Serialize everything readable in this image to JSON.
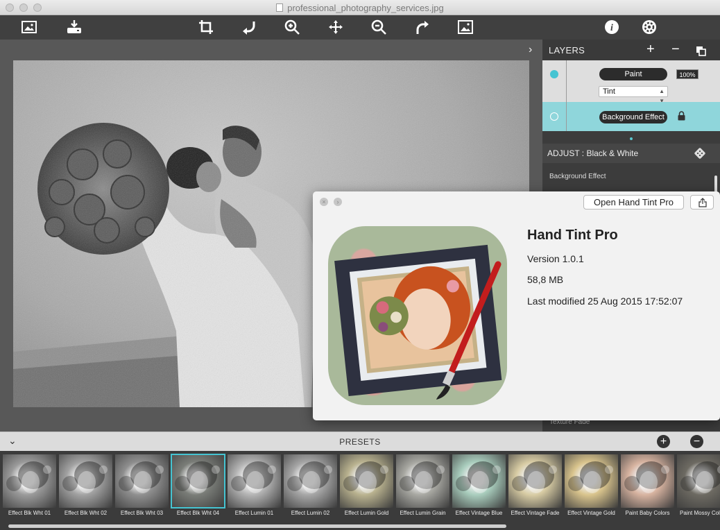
{
  "window": {
    "title": "professional_photography_services.jpg"
  },
  "toolbar": {
    "left_icons": [
      "open-image-icon",
      "save-export-icon"
    ],
    "center_icons": [
      "crop-icon",
      "rotate-left-icon",
      "zoom-in-icon",
      "move-icon",
      "zoom-out-icon",
      "rotate-right-icon",
      "fit-image-icon"
    ],
    "right_icons": [
      "info-icon",
      "settings-icon"
    ]
  },
  "layers": {
    "title": "LAYERS",
    "add_label": "+",
    "remove_label": "−",
    "items": [
      {
        "name": "Paint",
        "opacity": "100%",
        "blend": "Tint",
        "selected": false
      },
      {
        "name": "Background Effect",
        "locked": true,
        "selected": true
      }
    ]
  },
  "adjust": {
    "title": "ADJUST : Black & White",
    "section": "Background Effect",
    "hidden_row": "Texture Fade"
  },
  "about": {
    "open_button": "Open Hand Tint Pro",
    "app_name": "Hand Tint Pro",
    "version": "Version 1.0.1",
    "size": "58,8 MB",
    "modified": "Last modified 25 Aug 2015 17:52:07"
  },
  "presets": {
    "title": "PRESETS",
    "add_label": "+",
    "remove_label": "−",
    "items": [
      {
        "label": "Effect Blk Wht 01",
        "tone": "#9a9a9a",
        "selected": false
      },
      {
        "label": "Effect Blk Wht 02",
        "tone": "#a2a2a2",
        "selected": false
      },
      {
        "label": "Effect Blk Wht 03",
        "tone": "#8f8f8f",
        "selected": false
      },
      {
        "label": "Effect Blk Wht 04",
        "tone": "#7a7d78",
        "selected": true
      },
      {
        "label": "Effect Lumin 01",
        "tone": "#b3b3b3",
        "selected": false
      },
      {
        "label": "Effect Lumin 02",
        "tone": "#a6a6a6",
        "selected": false
      },
      {
        "label": "Effect Lumin Gold",
        "tone": "#b9b28f",
        "selected": false
      },
      {
        "label": "Effect Lumin Grain",
        "tone": "#a8a8a2",
        "selected": false
      },
      {
        "label": "Effect Vintage Blue",
        "tone": "#a9cdbd",
        "selected": false
      },
      {
        "label": "Effect Vintage Fade",
        "tone": "#d8cca4",
        "selected": false
      },
      {
        "label": "Effect Vintage Gold",
        "tone": "#d9c48d",
        "selected": false
      },
      {
        "label": "Paint Baby Colors",
        "tone": "#d7b3a0",
        "selected": false
      },
      {
        "label": "Paint Mossy Colors",
        "tone": "#6d6a62",
        "selected": false
      }
    ]
  },
  "colors": {
    "accent": "#45c4d2",
    "layer_selected": "#8fd6db",
    "toolbar": "#404040"
  }
}
